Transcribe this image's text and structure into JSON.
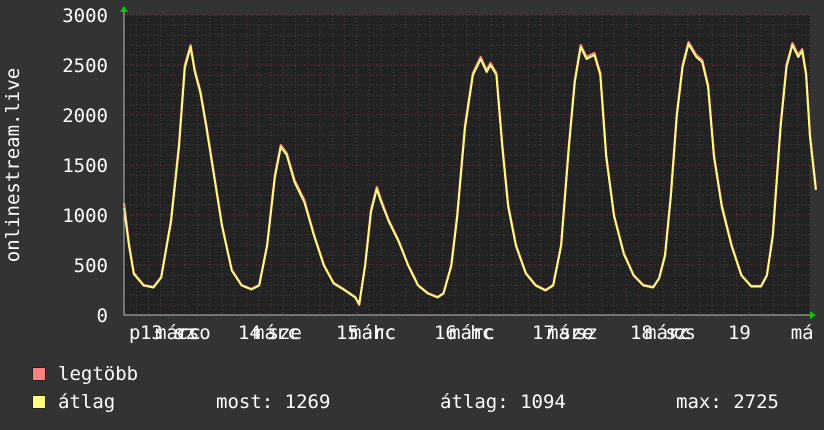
{
  "chart_data": {
    "type": "line",
    "ylabel": "onlinestream.live",
    "ylim": [
      0,
      3000
    ],
    "yticks": [
      0,
      500,
      1000,
      1500,
      2000,
      2500,
      3000
    ],
    "xlim": [
      0,
      7.0
    ],
    "xticks": [
      {
        "x": 0.11,
        "label": "p"
      },
      {
        "x": 0.28,
        "label": "13"
      },
      {
        "x": 0.55,
        "label": "márc"
      },
      {
        "x": 0.62,
        "label": "sz"
      },
      {
        "x": 0.71,
        "label": "cso"
      },
      {
        "x": 1.28,
        "label": "14"
      },
      {
        "x": 1.55,
        "label": "márc"
      },
      {
        "x": 1.64,
        "label": "sze"
      },
      {
        "x": 2.28,
        "label": "15"
      },
      {
        "x": 2.54,
        "label": "márc"
      },
      {
        "x": 2.66,
        "label": "hc"
      },
      {
        "x": 3.28,
        "label": "16"
      },
      {
        "x": 3.55,
        "label": "márc"
      },
      {
        "x": 3.65,
        "label": "hc"
      },
      {
        "x": 4.28,
        "label": "17"
      },
      {
        "x": 4.55,
        "label": "márc"
      },
      {
        "x": 4.62,
        "label": "sze"
      },
      {
        "x": 4.72,
        "label": "sz"
      },
      {
        "x": 5.28,
        "label": "18"
      },
      {
        "x": 5.55,
        "label": "márc"
      },
      {
        "x": 5.64,
        "label": "sz"
      },
      {
        "x": 5.72,
        "label": "cs"
      },
      {
        "x": 6.28,
        "label": "19"
      },
      {
        "x": 6.92,
        "label": "má"
      }
    ],
    "series": [
      {
        "name": "legtöbb",
        "color": "#ff8080",
        "points": [
          [
            0.0,
            1120
          ],
          [
            0.05,
            720
          ],
          [
            0.1,
            420
          ],
          [
            0.2,
            300
          ],
          [
            0.3,
            280
          ],
          [
            0.38,
            380
          ],
          [
            0.48,
            950
          ],
          [
            0.56,
            1700
          ],
          [
            0.62,
            2500
          ],
          [
            0.68,
            2700
          ],
          [
            0.72,
            2460
          ],
          [
            0.78,
            2240
          ],
          [
            0.84,
            1900
          ],
          [
            0.92,
            1400
          ],
          [
            1.0,
            900
          ],
          [
            1.1,
            450
          ],
          [
            1.2,
            300
          ],
          [
            1.3,
            260
          ],
          [
            1.38,
            300
          ],
          [
            1.46,
            700
          ],
          [
            1.54,
            1400
          ],
          [
            1.6,
            1700
          ],
          [
            1.66,
            1620
          ],
          [
            1.74,
            1350
          ],
          [
            1.84,
            1150
          ],
          [
            1.94,
            800
          ],
          [
            2.04,
            500
          ],
          [
            2.14,
            320
          ],
          [
            2.24,
            260
          ],
          [
            2.3,
            220
          ],
          [
            2.36,
            180
          ],
          [
            2.4,
            100
          ],
          [
            2.46,
            500
          ],
          [
            2.52,
            1050
          ],
          [
            2.58,
            1280
          ],
          [
            2.62,
            1160
          ],
          [
            2.7,
            950
          ],
          [
            2.8,
            750
          ],
          [
            2.9,
            500
          ],
          [
            3.0,
            300
          ],
          [
            3.1,
            220
          ],
          [
            3.2,
            180
          ],
          [
            3.26,
            220
          ],
          [
            3.34,
            500
          ],
          [
            3.4,
            1000
          ],
          [
            3.48,
            1900
          ],
          [
            3.56,
            2420
          ],
          [
            3.64,
            2580
          ],
          [
            3.7,
            2450
          ],
          [
            3.74,
            2520
          ],
          [
            3.8,
            2420
          ],
          [
            3.86,
            1700
          ],
          [
            3.92,
            1100
          ],
          [
            4.0,
            700
          ],
          [
            4.1,
            420
          ],
          [
            4.2,
            300
          ],
          [
            4.3,
            250
          ],
          [
            4.38,
            300
          ],
          [
            4.46,
            700
          ],
          [
            4.54,
            1700
          ],
          [
            4.6,
            2350
          ],
          [
            4.66,
            2700
          ],
          [
            4.72,
            2580
          ],
          [
            4.8,
            2620
          ],
          [
            4.86,
            2420
          ],
          [
            4.92,
            1600
          ],
          [
            5.0,
            1000
          ],
          [
            5.1,
            620
          ],
          [
            5.2,
            400
          ],
          [
            5.3,
            300
          ],
          [
            5.4,
            280
          ],
          [
            5.46,
            370
          ],
          [
            5.52,
            600
          ],
          [
            5.58,
            1200
          ],
          [
            5.64,
            2000
          ],
          [
            5.7,
            2500
          ],
          [
            5.76,
            2730
          ],
          [
            5.84,
            2600
          ],
          [
            5.9,
            2550
          ],
          [
            5.96,
            2300
          ],
          [
            6.02,
            1600
          ],
          [
            6.1,
            1100
          ],
          [
            6.2,
            700
          ],
          [
            6.3,
            400
          ],
          [
            6.4,
            290
          ],
          [
            6.5,
            290
          ],
          [
            6.56,
            400
          ],
          [
            6.62,
            800
          ],
          [
            6.7,
            1900
          ],
          [
            6.76,
            2500
          ],
          [
            6.82,
            2720
          ],
          [
            6.88,
            2600
          ],
          [
            6.92,
            2660
          ],
          [
            6.96,
            2420
          ],
          [
            7.0,
            1800
          ],
          [
            7.06,
            1269
          ]
        ]
      },
      {
        "name": "átlag",
        "color": "#ffff80",
        "points": [
          [
            0.0,
            1070
          ],
          [
            0.05,
            700
          ],
          [
            0.1,
            410
          ],
          [
            0.2,
            295
          ],
          [
            0.3,
            275
          ],
          [
            0.38,
            375
          ],
          [
            0.48,
            930
          ],
          [
            0.56,
            1670
          ],
          [
            0.62,
            2470
          ],
          [
            0.68,
            2680
          ],
          [
            0.72,
            2440
          ],
          [
            0.78,
            2220
          ],
          [
            0.84,
            1880
          ],
          [
            0.92,
            1380
          ],
          [
            1.0,
            890
          ],
          [
            1.1,
            445
          ],
          [
            1.2,
            295
          ],
          [
            1.3,
            255
          ],
          [
            1.38,
            295
          ],
          [
            1.46,
            690
          ],
          [
            1.54,
            1380
          ],
          [
            1.6,
            1680
          ],
          [
            1.66,
            1600
          ],
          [
            1.74,
            1330
          ],
          [
            1.84,
            1130
          ],
          [
            1.94,
            790
          ],
          [
            2.04,
            495
          ],
          [
            2.14,
            315
          ],
          [
            2.24,
            255
          ],
          [
            2.3,
            215
          ],
          [
            2.36,
            175
          ],
          [
            2.4,
            110
          ],
          [
            2.46,
            490
          ],
          [
            2.52,
            1030
          ],
          [
            2.58,
            1260
          ],
          [
            2.62,
            1140
          ],
          [
            2.7,
            940
          ],
          [
            2.8,
            740
          ],
          [
            2.9,
            495
          ],
          [
            3.0,
            295
          ],
          [
            3.1,
            215
          ],
          [
            3.2,
            175
          ],
          [
            3.26,
            215
          ],
          [
            3.34,
            490
          ],
          [
            3.4,
            980
          ],
          [
            3.48,
            1870
          ],
          [
            3.56,
            2400
          ],
          [
            3.64,
            2560
          ],
          [
            3.7,
            2430
          ],
          [
            3.74,
            2500
          ],
          [
            3.8,
            2400
          ],
          [
            3.86,
            1680
          ],
          [
            3.92,
            1080
          ],
          [
            4.0,
            690
          ],
          [
            4.1,
            415
          ],
          [
            4.2,
            295
          ],
          [
            4.3,
            245
          ],
          [
            4.38,
            295
          ],
          [
            4.46,
            690
          ],
          [
            4.54,
            1680
          ],
          [
            4.6,
            2330
          ],
          [
            4.66,
            2680
          ],
          [
            4.72,
            2560
          ],
          [
            4.8,
            2600
          ],
          [
            4.86,
            2400
          ],
          [
            4.92,
            1580
          ],
          [
            5.0,
            990
          ],
          [
            5.1,
            610
          ],
          [
            5.2,
            395
          ],
          [
            5.3,
            295
          ],
          [
            5.4,
            275
          ],
          [
            5.46,
            365
          ],
          [
            5.52,
            590
          ],
          [
            5.58,
            1180
          ],
          [
            5.64,
            1980
          ],
          [
            5.7,
            2480
          ],
          [
            5.76,
            2710
          ],
          [
            5.84,
            2580
          ],
          [
            5.9,
            2530
          ],
          [
            5.96,
            2280
          ],
          [
            6.02,
            1580
          ],
          [
            6.1,
            1080
          ],
          [
            6.2,
            690
          ],
          [
            6.3,
            395
          ],
          [
            6.4,
            285
          ],
          [
            6.5,
            285
          ],
          [
            6.56,
            395
          ],
          [
            6.62,
            790
          ],
          [
            6.7,
            1880
          ],
          [
            6.76,
            2480
          ],
          [
            6.82,
            2700
          ],
          [
            6.88,
            2580
          ],
          [
            6.92,
            2640
          ],
          [
            6.96,
            2400
          ],
          [
            7.0,
            1780
          ],
          [
            7.06,
            1250
          ]
        ]
      }
    ]
  },
  "legend": [
    {
      "label": "legtöbb",
      "color": "#ff8080"
    },
    {
      "label": "átlag",
      "color": "#ffff80"
    }
  ],
  "stats": {
    "now": "most: 1269",
    "avg": "átlag: 1094",
    "max": "max: 2725"
  }
}
